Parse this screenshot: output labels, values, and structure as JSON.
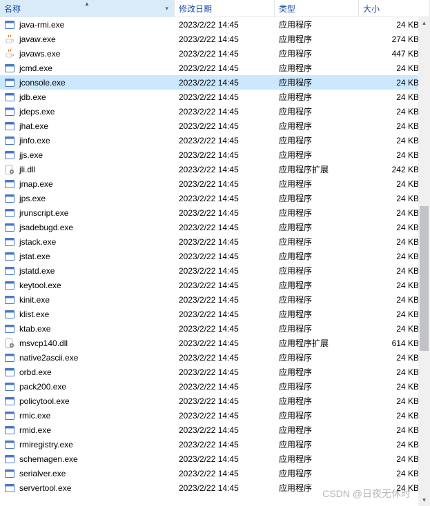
{
  "columns": {
    "name": "名称",
    "date": "修改日期",
    "type": "类型",
    "size": "大小"
  },
  "icon_kinds": {
    "exe": "app-exe-icon",
    "java": "java-exe-icon",
    "dll": "dll-file-icon"
  },
  "type_labels": {
    "app": "应用程序",
    "ext": "应用程序扩展"
  },
  "selected_index": 4,
  "files": [
    {
      "name": "java-rmi.exe",
      "date": "2023/2/22 14:45",
      "type": "app",
      "size": "24 KB",
      "icon": "exe"
    },
    {
      "name": "javaw.exe",
      "date": "2023/2/22 14:45",
      "type": "app",
      "size": "274 KB",
      "icon": "java"
    },
    {
      "name": "javaws.exe",
      "date": "2023/2/22 14:45",
      "type": "app",
      "size": "447 KB",
      "icon": "java"
    },
    {
      "name": "jcmd.exe",
      "date": "2023/2/22 14:45",
      "type": "app",
      "size": "24 KB",
      "icon": "exe"
    },
    {
      "name": "jconsole.exe",
      "date": "2023/2/22 14:45",
      "type": "app",
      "size": "24 KB",
      "icon": "exe"
    },
    {
      "name": "jdb.exe",
      "date": "2023/2/22 14:45",
      "type": "app",
      "size": "24 KB",
      "icon": "exe"
    },
    {
      "name": "jdeps.exe",
      "date": "2023/2/22 14:45",
      "type": "app",
      "size": "24 KB",
      "icon": "exe"
    },
    {
      "name": "jhat.exe",
      "date": "2023/2/22 14:45",
      "type": "app",
      "size": "24 KB",
      "icon": "exe"
    },
    {
      "name": "jinfo.exe",
      "date": "2023/2/22 14:45",
      "type": "app",
      "size": "24 KB",
      "icon": "exe"
    },
    {
      "name": "jjs.exe",
      "date": "2023/2/22 14:45",
      "type": "app",
      "size": "24 KB",
      "icon": "exe"
    },
    {
      "name": "jli.dll",
      "date": "2023/2/22 14:45",
      "type": "ext",
      "size": "242 KB",
      "icon": "dll"
    },
    {
      "name": "jmap.exe",
      "date": "2023/2/22 14:45",
      "type": "app",
      "size": "24 KB",
      "icon": "exe"
    },
    {
      "name": "jps.exe",
      "date": "2023/2/22 14:45",
      "type": "app",
      "size": "24 KB",
      "icon": "exe"
    },
    {
      "name": "jrunscript.exe",
      "date": "2023/2/22 14:45",
      "type": "app",
      "size": "24 KB",
      "icon": "exe"
    },
    {
      "name": "jsadebugd.exe",
      "date": "2023/2/22 14:45",
      "type": "app",
      "size": "24 KB",
      "icon": "exe"
    },
    {
      "name": "jstack.exe",
      "date": "2023/2/22 14:45",
      "type": "app",
      "size": "24 KB",
      "icon": "exe"
    },
    {
      "name": "jstat.exe",
      "date": "2023/2/22 14:45",
      "type": "app",
      "size": "24 KB",
      "icon": "exe"
    },
    {
      "name": "jstatd.exe",
      "date": "2023/2/22 14:45",
      "type": "app",
      "size": "24 KB",
      "icon": "exe"
    },
    {
      "name": "keytool.exe",
      "date": "2023/2/22 14:45",
      "type": "app",
      "size": "24 KB",
      "icon": "exe"
    },
    {
      "name": "kinit.exe",
      "date": "2023/2/22 14:45",
      "type": "app",
      "size": "24 KB",
      "icon": "exe"
    },
    {
      "name": "klist.exe",
      "date": "2023/2/22 14:45",
      "type": "app",
      "size": "24 KB",
      "icon": "exe"
    },
    {
      "name": "ktab.exe",
      "date": "2023/2/22 14:45",
      "type": "app",
      "size": "24 KB",
      "icon": "exe"
    },
    {
      "name": "msvcp140.dll",
      "date": "2023/2/22 14:45",
      "type": "ext",
      "size": "614 KB",
      "icon": "dll"
    },
    {
      "name": "native2ascii.exe",
      "date": "2023/2/22 14:45",
      "type": "app",
      "size": "24 KB",
      "icon": "exe"
    },
    {
      "name": "orbd.exe",
      "date": "2023/2/22 14:45",
      "type": "app",
      "size": "24 KB",
      "icon": "exe"
    },
    {
      "name": "pack200.exe",
      "date": "2023/2/22 14:45",
      "type": "app",
      "size": "24 KB",
      "icon": "exe"
    },
    {
      "name": "policytool.exe",
      "date": "2023/2/22 14:45",
      "type": "app",
      "size": "24 KB",
      "icon": "exe"
    },
    {
      "name": "rmic.exe",
      "date": "2023/2/22 14:45",
      "type": "app",
      "size": "24 KB",
      "icon": "exe"
    },
    {
      "name": "rmid.exe",
      "date": "2023/2/22 14:45",
      "type": "app",
      "size": "24 KB",
      "icon": "exe"
    },
    {
      "name": "rmiregistry.exe",
      "date": "2023/2/22 14:45",
      "type": "app",
      "size": "24 KB",
      "icon": "exe"
    },
    {
      "name": "schemagen.exe",
      "date": "2023/2/22 14:45",
      "type": "app",
      "size": "24 KB",
      "icon": "exe"
    },
    {
      "name": "serialver.exe",
      "date": "2023/2/22 14:45",
      "type": "app",
      "size": "24 KB",
      "icon": "exe"
    },
    {
      "name": "servertool.exe",
      "date": "2023/2/22 14:45",
      "type": "app",
      "size": "24 KB",
      "icon": "exe"
    }
  ],
  "watermark": "CSDN @日夜无休时"
}
